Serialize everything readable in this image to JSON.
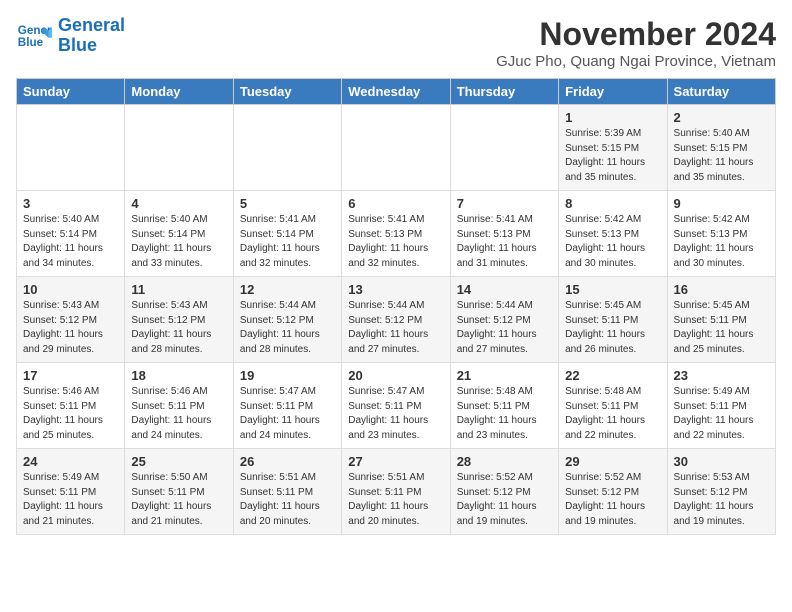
{
  "header": {
    "logo_line1": "General",
    "logo_line2": "Blue",
    "month_year": "November 2024",
    "location": "GJuc Pho, Quang Ngai Province, Vietnam"
  },
  "days_of_week": [
    "Sunday",
    "Monday",
    "Tuesday",
    "Wednesday",
    "Thursday",
    "Friday",
    "Saturday"
  ],
  "weeks": [
    [
      {
        "day": null,
        "info": null
      },
      {
        "day": null,
        "info": null
      },
      {
        "day": null,
        "info": null
      },
      {
        "day": null,
        "info": null
      },
      {
        "day": null,
        "info": null
      },
      {
        "day": "1",
        "info": "Sunrise: 5:39 AM\nSunset: 5:15 PM\nDaylight: 11 hours\nand 35 minutes."
      },
      {
        "day": "2",
        "info": "Sunrise: 5:40 AM\nSunset: 5:15 PM\nDaylight: 11 hours\nand 35 minutes."
      }
    ],
    [
      {
        "day": "3",
        "info": "Sunrise: 5:40 AM\nSunset: 5:14 PM\nDaylight: 11 hours\nand 34 minutes."
      },
      {
        "day": "4",
        "info": "Sunrise: 5:40 AM\nSunset: 5:14 PM\nDaylight: 11 hours\nand 33 minutes."
      },
      {
        "day": "5",
        "info": "Sunrise: 5:41 AM\nSunset: 5:14 PM\nDaylight: 11 hours\nand 32 minutes."
      },
      {
        "day": "6",
        "info": "Sunrise: 5:41 AM\nSunset: 5:13 PM\nDaylight: 11 hours\nand 32 minutes."
      },
      {
        "day": "7",
        "info": "Sunrise: 5:41 AM\nSunset: 5:13 PM\nDaylight: 11 hours\nand 31 minutes."
      },
      {
        "day": "8",
        "info": "Sunrise: 5:42 AM\nSunset: 5:13 PM\nDaylight: 11 hours\nand 30 minutes."
      },
      {
        "day": "9",
        "info": "Sunrise: 5:42 AM\nSunset: 5:13 PM\nDaylight: 11 hours\nand 30 minutes."
      }
    ],
    [
      {
        "day": "10",
        "info": "Sunrise: 5:43 AM\nSunset: 5:12 PM\nDaylight: 11 hours\nand 29 minutes."
      },
      {
        "day": "11",
        "info": "Sunrise: 5:43 AM\nSunset: 5:12 PM\nDaylight: 11 hours\nand 28 minutes."
      },
      {
        "day": "12",
        "info": "Sunrise: 5:44 AM\nSunset: 5:12 PM\nDaylight: 11 hours\nand 28 minutes."
      },
      {
        "day": "13",
        "info": "Sunrise: 5:44 AM\nSunset: 5:12 PM\nDaylight: 11 hours\nand 27 minutes."
      },
      {
        "day": "14",
        "info": "Sunrise: 5:44 AM\nSunset: 5:12 PM\nDaylight: 11 hours\nand 27 minutes."
      },
      {
        "day": "15",
        "info": "Sunrise: 5:45 AM\nSunset: 5:11 PM\nDaylight: 11 hours\nand 26 minutes."
      },
      {
        "day": "16",
        "info": "Sunrise: 5:45 AM\nSunset: 5:11 PM\nDaylight: 11 hours\nand 25 minutes."
      }
    ],
    [
      {
        "day": "17",
        "info": "Sunrise: 5:46 AM\nSunset: 5:11 PM\nDaylight: 11 hours\nand 25 minutes."
      },
      {
        "day": "18",
        "info": "Sunrise: 5:46 AM\nSunset: 5:11 PM\nDaylight: 11 hours\nand 24 minutes."
      },
      {
        "day": "19",
        "info": "Sunrise: 5:47 AM\nSunset: 5:11 PM\nDaylight: 11 hours\nand 24 minutes."
      },
      {
        "day": "20",
        "info": "Sunrise: 5:47 AM\nSunset: 5:11 PM\nDaylight: 11 hours\nand 23 minutes."
      },
      {
        "day": "21",
        "info": "Sunrise: 5:48 AM\nSunset: 5:11 PM\nDaylight: 11 hours\nand 23 minutes."
      },
      {
        "day": "22",
        "info": "Sunrise: 5:48 AM\nSunset: 5:11 PM\nDaylight: 11 hours\nand 22 minutes."
      },
      {
        "day": "23",
        "info": "Sunrise: 5:49 AM\nSunset: 5:11 PM\nDaylight: 11 hours\nand 22 minutes."
      }
    ],
    [
      {
        "day": "24",
        "info": "Sunrise: 5:49 AM\nSunset: 5:11 PM\nDaylight: 11 hours\nand 21 minutes."
      },
      {
        "day": "25",
        "info": "Sunrise: 5:50 AM\nSunset: 5:11 PM\nDaylight: 11 hours\nand 21 minutes."
      },
      {
        "day": "26",
        "info": "Sunrise: 5:51 AM\nSunset: 5:11 PM\nDaylight: 11 hours\nand 20 minutes."
      },
      {
        "day": "27",
        "info": "Sunrise: 5:51 AM\nSunset: 5:11 PM\nDaylight: 11 hours\nand 20 minutes."
      },
      {
        "day": "28",
        "info": "Sunrise: 5:52 AM\nSunset: 5:12 PM\nDaylight: 11 hours\nand 19 minutes."
      },
      {
        "day": "29",
        "info": "Sunrise: 5:52 AM\nSunset: 5:12 PM\nDaylight: 11 hours\nand 19 minutes."
      },
      {
        "day": "30",
        "info": "Sunrise: 5:53 AM\nSunset: 5:12 PM\nDaylight: 11 hours\nand 19 minutes."
      }
    ]
  ]
}
